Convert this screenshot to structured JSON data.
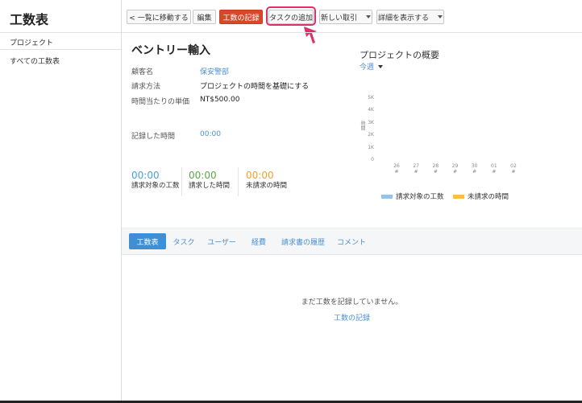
{
  "app": {
    "title": "工数表"
  },
  "sidebar": {
    "items": [
      {
        "label": "プロジェクト"
      },
      {
        "label": "すべての工数表"
      }
    ]
  },
  "toolbar": {
    "back_label": "< 一覧に移動する",
    "edit_label": "編集",
    "log_time_label": "工数の記録",
    "add_task_label": "タスクの追加",
    "new_transaction_label": "新しい取引",
    "show_details_label": "詳細を表示する"
  },
  "project": {
    "title": "ベントリー輸入",
    "fields": [
      {
        "label": "顧客名",
        "value": "保安警部"
      },
      {
        "label": "請求方法",
        "value": "プロジェクトの時間を基礎にする"
      },
      {
        "label": "時間当たりの単価",
        "value": "NT$500.00"
      },
      {
        "label": "記録した時間",
        "value": "00:00"
      }
    ],
    "metrics": [
      {
        "value": "00:00",
        "label": "請求対象の工数",
        "color": "#4a9fd8"
      },
      {
        "value": "00:00",
        "label": "請求した時間",
        "color": "#5aa845"
      },
      {
        "value": "00:00",
        "label": "未請求の時間",
        "color": "#f0a030"
      }
    ]
  },
  "overview": {
    "title": "プロジェクトの概要",
    "period": "今週"
  },
  "chart_data": {
    "type": "bar",
    "categories": [
      "26",
      "27",
      "28",
      "29",
      "30",
      "01",
      "02"
    ],
    "category_sub": "#",
    "yticks": [
      "5K",
      "4K",
      "3K",
      "2K",
      "1K",
      "0"
    ],
    "ylabel": "時間",
    "ylim": [
      0,
      5000
    ],
    "series": [
      {
        "name": "請求対象の工数",
        "color": "#8ec4ef",
        "values": [
          0,
          0,
          0,
          0,
          0,
          0,
          0
        ]
      },
      {
        "name": "未請求の時間",
        "color": "#f2c240",
        "values": [
          0,
          0,
          0,
          0,
          0,
          0,
          0
        ]
      }
    ]
  },
  "tabs": [
    {
      "label": "工数表"
    },
    {
      "label": "タスク"
    },
    {
      "label": "ユーザー"
    },
    {
      "label": "経費"
    },
    {
      "label": "請求書の履歴"
    },
    {
      "label": "コメント"
    }
  ],
  "empty": {
    "message": "まだ工数を記録していません。",
    "link": "工数の記録"
  },
  "colors": {
    "accent": "#3d8fd6",
    "danger": "#d9472b",
    "highlight": "#e0306a",
    "link": "#4a8fd0"
  }
}
